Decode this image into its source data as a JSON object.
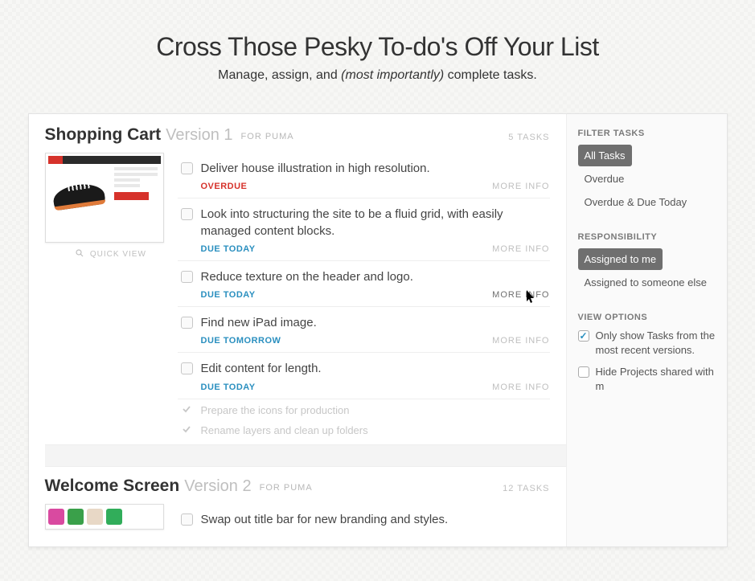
{
  "hero": {
    "title": "Cross Those Pesky To-do's Off Your List",
    "subtitle_pre": "Manage, assign, and ",
    "subtitle_em": "(most importantly)",
    "subtitle_post": " complete tasks."
  },
  "sections": [
    {
      "title": "Shopping Cart",
      "version": "Version 1",
      "client_label": "FOR PUMA",
      "task_count_label": "5 TASKS",
      "quickview_label": "QUICK VIEW",
      "tasks": [
        {
          "text": "Deliver house illustration in high resolution.",
          "due_label": "OVERDUE",
          "due_class": "overdue",
          "more": "MORE INFO",
          "more_active": false
        },
        {
          "text": "Look into structuring the site to be a fluid grid, with easily managed content blocks.",
          "due_label": "DUE TODAY",
          "due_class": "today",
          "more": "MORE INFO",
          "more_active": false
        },
        {
          "text": "Reduce texture on the header and logo.",
          "due_label": "DUE TODAY",
          "due_class": "today",
          "more": "MORE INFO",
          "more_active": true
        },
        {
          "text": "Find new iPad image.",
          "due_label": "DUE TOMORROW",
          "due_class": "tomorrow",
          "more": "MORE INFO",
          "more_active": false
        },
        {
          "text": "Edit content for length.",
          "due_label": "DUE TODAY",
          "due_class": "today",
          "more": "MORE INFO",
          "more_active": false
        }
      ],
      "completed": [
        "Prepare the icons for production",
        "Rename layers and clean up folders"
      ]
    },
    {
      "title": "Welcome Screen",
      "version": "Version 2",
      "client_label": "FOR PUMA",
      "task_count_label": "12 TASKS",
      "tasks": [
        {
          "text": "Swap out title bar for new branding and styles."
        }
      ]
    }
  ],
  "sidebar": {
    "filter": {
      "heading": "FILTER TASKS",
      "items": [
        "All Tasks",
        "Overdue",
        "Overdue & Due Today"
      ],
      "active_index": 0
    },
    "responsibility": {
      "heading": "RESPONSIBILITY",
      "items": [
        "Assigned to me",
        "Assigned to someone else"
      ],
      "active_index": 0
    },
    "view_options": {
      "heading": "VIEW OPTIONS",
      "options": [
        {
          "label": "Only show Tasks from the most recent versions.",
          "checked": true
        },
        {
          "label": "Hide Projects shared with m",
          "checked": false
        }
      ]
    }
  }
}
